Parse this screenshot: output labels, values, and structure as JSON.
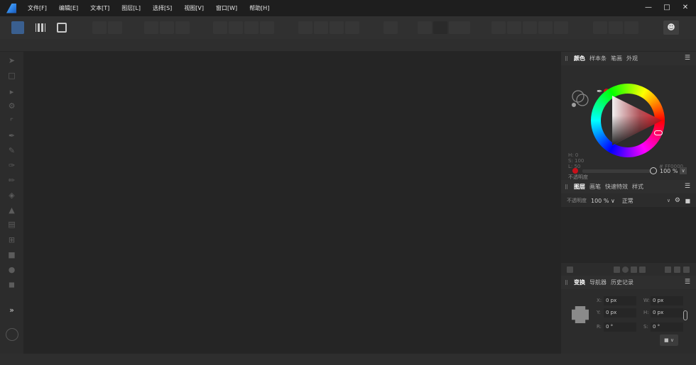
{
  "menu": {
    "items": [
      "文件[F]",
      "编辑[E]",
      "文本[T]",
      "图层[L]",
      "选择[S]",
      "视图[V]",
      "窗口[W]",
      "帮助[H]"
    ]
  },
  "window_controls": {
    "minimize": "—",
    "maximize": "□",
    "close": "✕"
  },
  "toolbar": {
    "user_icon": "user-icon"
  },
  "color_panel": {
    "tabs": [
      "颜色",
      "样本条",
      "笔画",
      "外观"
    ],
    "active_tab": "颜色",
    "h": "H: 0",
    "s": "S: 100",
    "l": "L: 50",
    "hex": "# FF0000",
    "opacity_label": "不透明度",
    "opacity_value": "100 %",
    "current_color": "#c8101a"
  },
  "layers_panel": {
    "tabs": [
      "图层",
      "画笔",
      "快速特效",
      "样式"
    ],
    "active_tab": "图层",
    "opacity_label": "不透明度",
    "opacity_value": "100 % ∨",
    "blend_mode": "正常"
  },
  "transform_panel": {
    "tabs": [
      "变换",
      "导航器",
      "历史记录"
    ],
    "active_tab": "变换",
    "x_label": "X:",
    "x_value": "0 px",
    "y_label": "Y:",
    "y_value": "0 px",
    "w_label": "W:",
    "w_value": "0 px",
    "h_label": "H:",
    "h_value": "0 px",
    "r_label": "R:",
    "r_value": "0 °",
    "s_label": "S:",
    "s_value": "0 °"
  }
}
